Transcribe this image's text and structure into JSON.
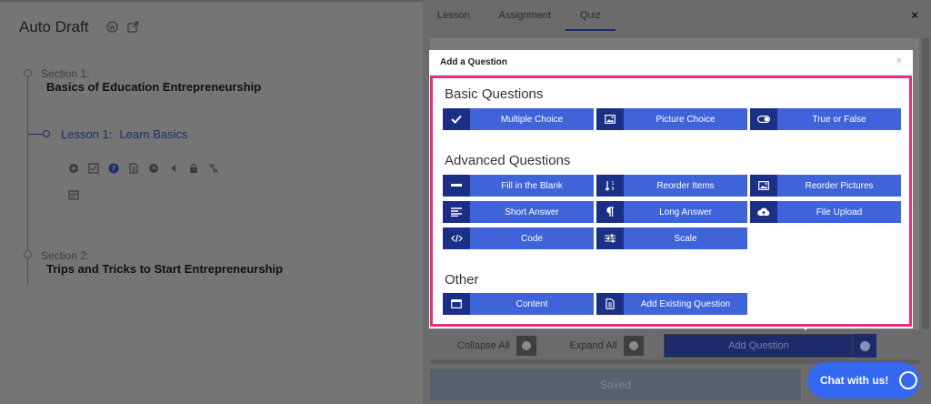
{
  "course": {
    "title": "Auto Draft",
    "sections": [
      {
        "label": "Section 1:",
        "title": "Basics of Education Entrepreneurship"
      },
      {
        "label": "Section 2:",
        "title": "Trips and Tricks to Start Entrepreneurship"
      }
    ],
    "lesson": {
      "label": "Lesson 1:",
      "title": "Learn Basics"
    }
  },
  "panel": {
    "tabs": [
      "Lesson",
      "Assignment",
      "Quiz"
    ],
    "active_tab": "Quiz",
    "close": "×",
    "collapse_all": "Collapse All",
    "expand_all": "Expand All",
    "add_question": "Add Question",
    "saved": "Saved"
  },
  "modal": {
    "title": "Add a Question",
    "close": "×",
    "basic": {
      "heading": "Basic Questions",
      "items": [
        "Multiple Choice",
        "Picture Choice",
        "True or False"
      ]
    },
    "advanced": {
      "heading": "Advanced Questions",
      "items": [
        "Fill in the Blank",
        "Reorder Items",
        "Reorder Pictures",
        "Short Answer",
        "Long Answer",
        "File Upload",
        "Code",
        "Scale"
      ]
    },
    "other": {
      "heading": "Other",
      "items": [
        "Content",
        "Add Existing Question"
      ]
    }
  },
  "chat": {
    "label": "Chat with us!"
  },
  "colors": {
    "accent": "#3f63d8",
    "icon_bg": "#1c2f86",
    "highlight": "#e2317c",
    "chat": "#3568f0"
  }
}
